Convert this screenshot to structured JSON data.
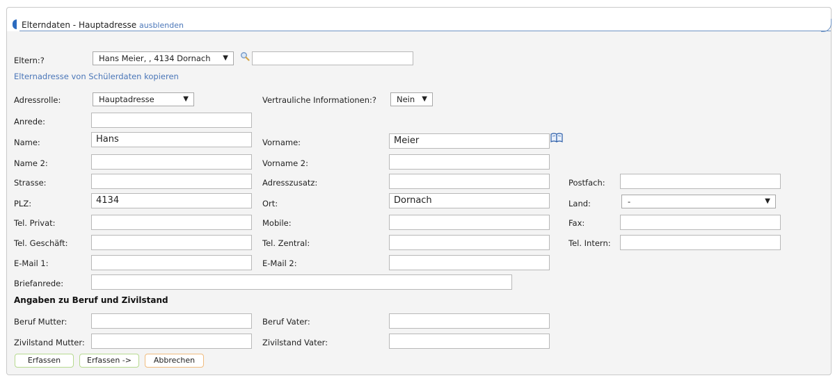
{
  "header": {
    "title": "Elterndaten - Hauptadresse",
    "toggle_link": "ausblenden"
  },
  "eltern": {
    "label": "Eltern:",
    "help": "?",
    "selected": "Hans Meier, , 4134 Dornach",
    "search_value": ""
  },
  "copy_link": "Elternadresse von Schülerdaten kopieren",
  "adressrolle": {
    "label": "Adressrolle:",
    "selected": "Hauptadresse"
  },
  "vertraulich": {
    "label": "Vertrauliche Informationen:",
    "help": "?",
    "selected": "Nein"
  },
  "fields": {
    "anrede": {
      "label": "Anrede:",
      "value": ""
    },
    "name": {
      "label": "Name:",
      "value": "Hans"
    },
    "vorname": {
      "label": "Vorname:",
      "value": "Meier"
    },
    "name2": {
      "label": "Name 2:",
      "value": ""
    },
    "vorname2": {
      "label": "Vorname 2:",
      "value": ""
    },
    "strasse": {
      "label": "Strasse:",
      "value": ""
    },
    "adresszusatz": {
      "label": "Adresszusatz:",
      "value": ""
    },
    "postfach": {
      "label": "Postfach:",
      "value": ""
    },
    "plz": {
      "label": "PLZ:",
      "value": "4134"
    },
    "ort": {
      "label": "Ort:",
      "value": "Dornach"
    },
    "land": {
      "label": "Land:",
      "selected": "-"
    },
    "tel_privat": {
      "label": "Tel. Privat:",
      "value": ""
    },
    "mobile": {
      "label": "Mobile:",
      "value": ""
    },
    "fax": {
      "label": "Fax:",
      "value": ""
    },
    "tel_geschaeft": {
      "label": "Tel. Geschäft:",
      "value": ""
    },
    "tel_zentral": {
      "label": "Tel. Zentral:",
      "value": ""
    },
    "tel_intern": {
      "label": "Tel. Intern:",
      "value": ""
    },
    "email1": {
      "label": "E-Mail 1:",
      "value": ""
    },
    "email2": {
      "label": "E-Mail 2:",
      "value": ""
    },
    "briefanrede": {
      "label": "Briefanrede:",
      "value": ""
    }
  },
  "section_beruf": "Angaben zu Beruf und Zivilstand",
  "beruf": {
    "beruf_mutter": {
      "label": "Beruf Mutter:",
      "value": ""
    },
    "beruf_vater": {
      "label": "Beruf Vater:",
      "value": ""
    },
    "zivil_mutter": {
      "label": "Zivilstand Mutter:",
      "value": ""
    },
    "zivil_vater": {
      "label": "Zivilstand Vater:",
      "value": ""
    }
  },
  "buttons": {
    "erfassen": "Erfassen",
    "erfassen_next": "Erfassen ->",
    "abbrechen": "Abbrechen"
  },
  "colors": {
    "link": "#4a76b8",
    "accent": "#2b6bbf",
    "btn_green": "#b6d98f",
    "btn_orange": "#f0bb7e"
  }
}
